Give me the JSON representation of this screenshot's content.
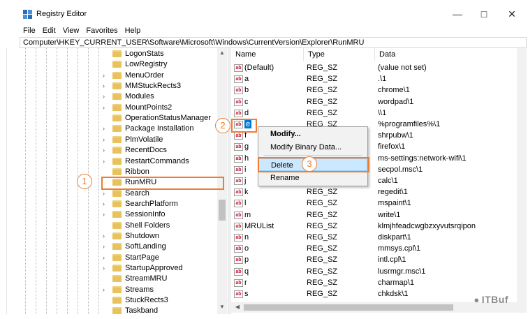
{
  "window": {
    "title": "Registry Editor",
    "controls": {
      "minimize": "—",
      "maximize": "□",
      "close": "✕"
    }
  },
  "menu": [
    "File",
    "Edit",
    "View",
    "Favorites",
    "Help"
  ],
  "address": "Computer\\HKEY_CURRENT_USER\\Software\\Microsoft\\Windows\\CurrentVersion\\Explorer\\RunMRU",
  "tree": {
    "items": [
      "LogonStats",
      "LowRegistry",
      "MenuOrder",
      "MMStuckRects3",
      "Modules",
      "MountPoints2",
      "OperationStatusManager",
      "Package Installation",
      "PlmVolatile",
      "RecentDocs",
      "RestartCommands",
      "Ribbon",
      "RunMRU",
      "Search",
      "SearchPlatform",
      "SessionInfo",
      "Shell Folders",
      "Shutdown",
      "SoftLanding",
      "StartPage",
      "StartupApproved",
      "StreamMRU",
      "Streams",
      "StuckRects3",
      "Taskband"
    ],
    "expandable": [
      false,
      false,
      true,
      true,
      true,
      true,
      false,
      true,
      true,
      true,
      true,
      false,
      false,
      true,
      true,
      true,
      false,
      true,
      true,
      true,
      true,
      false,
      true,
      false,
      false
    ],
    "selected": "RunMRU"
  },
  "values": {
    "columns": [
      "Name",
      "Type",
      "Data"
    ],
    "rows": [
      {
        "name": "(Default)",
        "type": "REG_SZ",
        "data": "(value not set)"
      },
      {
        "name": "a",
        "type": "REG_SZ",
        "data": ".\\1"
      },
      {
        "name": "b",
        "type": "REG_SZ",
        "data": "chrome\\1"
      },
      {
        "name": "c",
        "type": "REG_SZ",
        "data": "wordpad\\1"
      },
      {
        "name": "d",
        "type": "REG_SZ",
        "data": "\\\\1"
      },
      {
        "name": "e",
        "type": "REG_SZ",
        "data": "%programfiles%\\1"
      },
      {
        "name": "f",
        "type": "",
        "data": "shrpubw\\1"
      },
      {
        "name": "g",
        "type": "",
        "data": "firefox\\1"
      },
      {
        "name": "h",
        "type": "",
        "data": "ms-settings:network-wifi\\1"
      },
      {
        "name": "i",
        "type": "",
        "data": "secpol.msc\\1"
      },
      {
        "name": "j",
        "type": "",
        "data": "calc\\1"
      },
      {
        "name": "k",
        "type": "REG_SZ",
        "data": "regedit\\1"
      },
      {
        "name": "l",
        "type": "REG_SZ",
        "data": "mspaint\\1"
      },
      {
        "name": "m",
        "type": "REG_SZ",
        "data": "write\\1"
      },
      {
        "name": "MRUList",
        "type": "REG_SZ",
        "data": "klmjhfeadcwgbzxyvutsrqipon"
      },
      {
        "name": "n",
        "type": "REG_SZ",
        "data": "diskpart\\1"
      },
      {
        "name": "o",
        "type": "REG_SZ",
        "data": "mmsys.cpl\\1"
      },
      {
        "name": "p",
        "type": "REG_SZ",
        "data": "intl.cpl\\1"
      },
      {
        "name": "q",
        "type": "REG_SZ",
        "data": "lusrmgr.msc\\1"
      },
      {
        "name": "r",
        "type": "REG_SZ",
        "data": "charmap\\1"
      },
      {
        "name": "s",
        "type": "REG_SZ",
        "data": "chkdsk\\1"
      }
    ],
    "selected": "e"
  },
  "context_menu": {
    "items": [
      "Modify...",
      "Modify Binary Data...",
      "Delete",
      "Rename"
    ],
    "highlighted": "Delete"
  },
  "annotations": {
    "step1": "1",
    "step2": "2",
    "step3": "3"
  },
  "watermark": "ITBuf",
  "colors": {
    "accent": "#ed7d31",
    "selection": "#0078d7",
    "folder": "#e8c25c"
  }
}
